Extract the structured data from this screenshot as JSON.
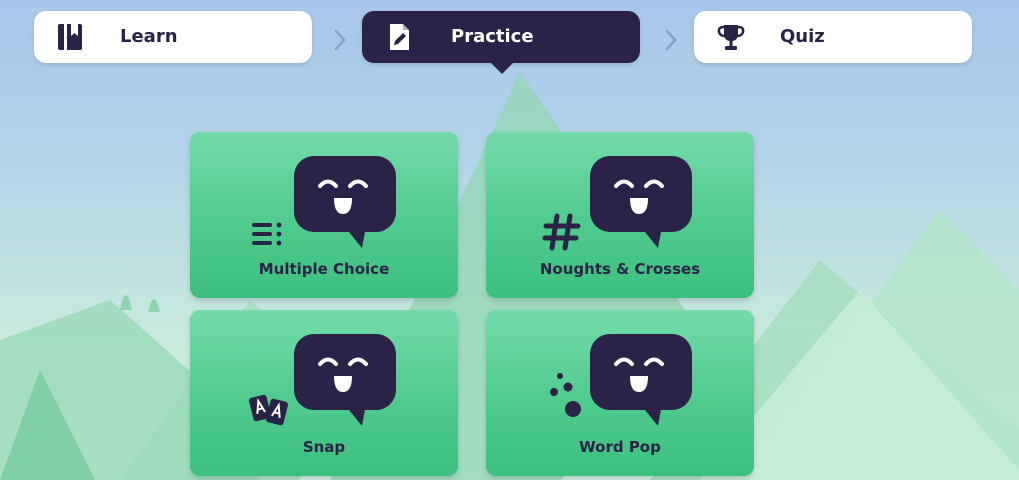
{
  "nav": {
    "tabs": [
      {
        "label": "Learn",
        "icon": "book-icon",
        "active": false
      },
      {
        "label": "Practice",
        "icon": "edit-document-icon",
        "active": true
      },
      {
        "label": "Quiz",
        "icon": "trophy-icon",
        "active": false
      }
    ]
  },
  "activities": [
    {
      "label": "Multiple Choice",
      "icon": "list-icon"
    },
    {
      "label": "Noughts & Crosses",
      "icon": "hashtag-icon"
    },
    {
      "label": "Snap",
      "icon": "cards-icon"
    },
    {
      "label": "Word Pop",
      "icon": "bubbles-icon"
    }
  ],
  "colors": {
    "dark": "#2a2347",
    "card_green": "#4fcb8d",
    "tab_white": "#ffffff"
  }
}
